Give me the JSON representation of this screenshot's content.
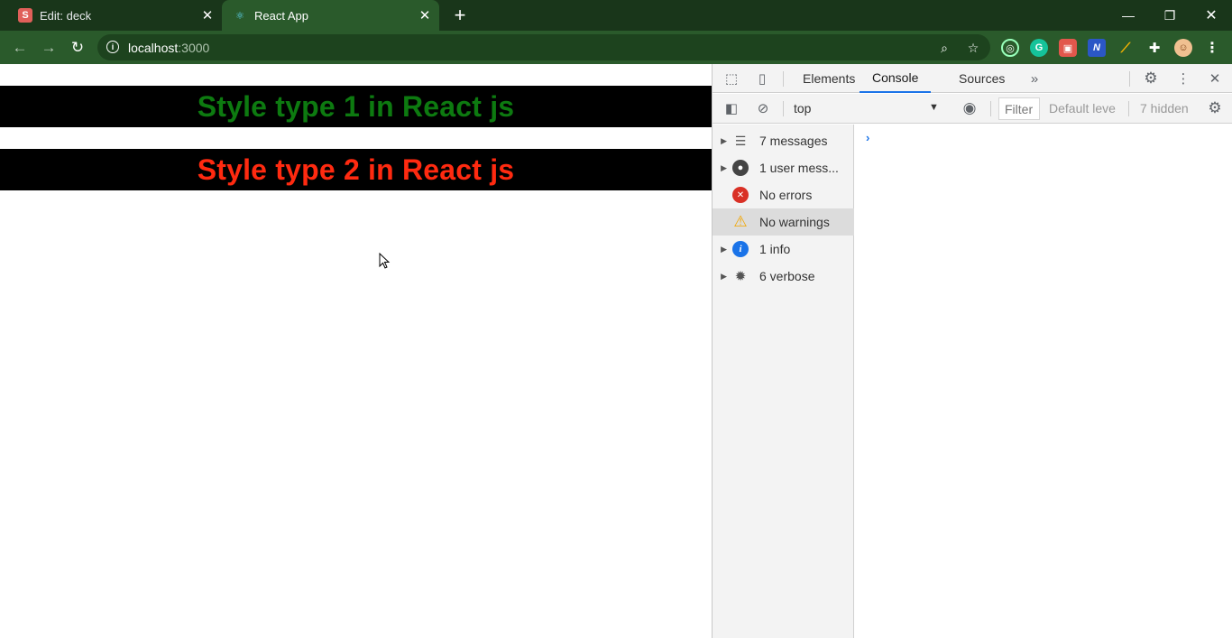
{
  "tabs": [
    {
      "title": "Edit: deck",
      "favicon": "S",
      "active": false
    },
    {
      "title": "React App",
      "favicon": "⚛",
      "active": true
    }
  ],
  "address": {
    "host": "localhost",
    "port": ":3000"
  },
  "page": {
    "heading1": "Style type 1 in React js",
    "heading2": "Style type 2 in React js",
    "heading1_color": "#0d7a10",
    "heading2_color": "#ff2a10",
    "banner_bg": "#000000"
  },
  "devtools": {
    "tabs": [
      "Elements",
      "Console",
      "Sources"
    ],
    "active_tab": "Console",
    "context": "top",
    "filter_placeholder": "Filter",
    "level": "Default leve",
    "hidden": "7 hidden",
    "sidebar": [
      {
        "label": "7 messages",
        "icon": "list-icon",
        "expandable": true
      },
      {
        "label": "1 user mess...",
        "icon": "user-icon",
        "expandable": true
      },
      {
        "label": "No errors",
        "icon": "error-icon",
        "expandable": false
      },
      {
        "label": "No warnings",
        "icon": "warning-icon",
        "expandable": false,
        "selected": true
      },
      {
        "label": "1 info",
        "icon": "info-icon",
        "expandable": true
      },
      {
        "label": "6 verbose",
        "icon": "bug-icon",
        "expandable": true
      }
    ],
    "prompt": "›"
  },
  "colors": {
    "chrome_dark": "#19361a",
    "chrome_toolbar": "#2a5a2b",
    "accent": "#1a73e8"
  }
}
